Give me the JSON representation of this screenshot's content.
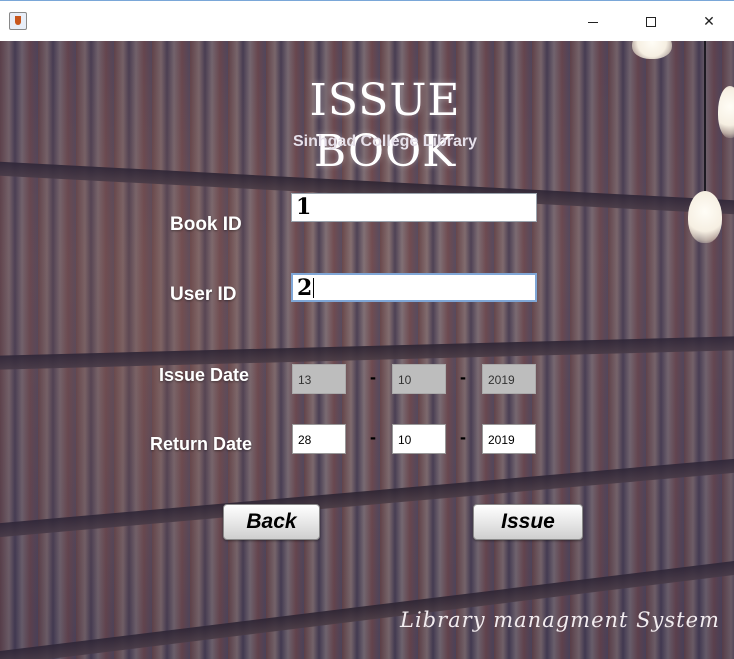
{
  "window": {
    "minimize_glyph": "—",
    "maximize_glyph": "☐",
    "close_glyph": "✕"
  },
  "header": {
    "title": "ISSUE BOOK",
    "subtitle": "Sinhgad College Library"
  },
  "form": {
    "book_id_label": "Book ID",
    "book_id_value": "1",
    "user_id_label": "User ID",
    "user_id_value": "2",
    "issue_date_label": "Issue Date",
    "issue_date": {
      "day": "13",
      "month": "10",
      "year": "2019"
    },
    "return_date_label": "Return Date",
    "return_date": {
      "day": "28",
      "month": "10",
      "year": "2019"
    },
    "separator": "-"
  },
  "buttons": {
    "back_label": "Back",
    "issue_label": "Issue"
  },
  "footer": {
    "text": "Library managment System"
  },
  "colors": {
    "label_text": "#ffffff",
    "disabled_field": "#bdbdbd",
    "focus_border": "#7fa6d6"
  }
}
